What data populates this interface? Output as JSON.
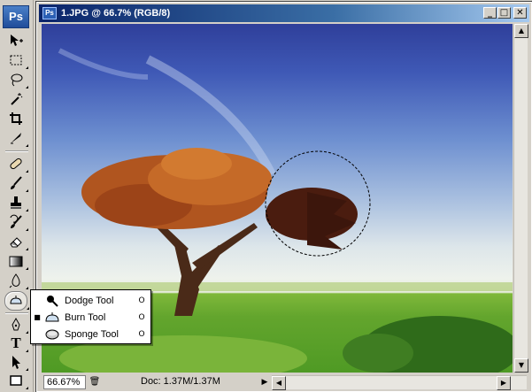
{
  "app": {
    "logo_text": "Ps"
  },
  "document": {
    "title": "1.JPG @ 66.7% (RGB/8)",
    "icon_text": "Ps",
    "buttons": {
      "minimize": "_",
      "maximize": "□",
      "close": "✕"
    }
  },
  "status": {
    "zoom": "66.67%",
    "doc_info": "Doc: 1.37M/1.37M",
    "arrow": "▶"
  },
  "scroll": {
    "up": "▲",
    "down": "▼",
    "left": "◀",
    "right": "▶"
  },
  "toolbox": {
    "tools": [
      {
        "name": "move-tool",
        "icon": "move-icon"
      },
      {
        "name": "marquee-tool",
        "icon": "rectangular-marquee-icon"
      },
      {
        "name": "lasso-tool",
        "icon": "lasso-icon"
      },
      {
        "name": "magic-wand-tool",
        "icon": "magic-wand-icon"
      },
      {
        "name": "crop-tool",
        "icon": "crop-icon"
      },
      {
        "name": "slice-tool",
        "icon": "slice-icon"
      },
      {
        "name": "healing-brush-tool",
        "icon": "bandage-icon"
      },
      {
        "name": "brush-tool",
        "icon": "brush-icon"
      },
      {
        "name": "clone-stamp-tool",
        "icon": "stamp-icon"
      },
      {
        "name": "history-brush-tool",
        "icon": "history-brush-icon"
      },
      {
        "name": "eraser-tool",
        "icon": "eraser-icon"
      },
      {
        "name": "gradient-tool",
        "icon": "gradient-icon"
      },
      {
        "name": "blur-tool",
        "icon": "blur-drop-icon"
      },
      {
        "name": "burn-tool",
        "icon": "burn-icon"
      },
      {
        "name": "pen-tool",
        "icon": "pen-icon"
      },
      {
        "name": "type-tool",
        "icon": "type-icon"
      },
      {
        "name": "path-selection-tool",
        "icon": "arrow-icon"
      },
      {
        "name": "shape-tool",
        "icon": "rectangle-shape-icon"
      }
    ],
    "type_glyph": "T"
  },
  "flyout": {
    "items": [
      {
        "label": "Dodge Tool",
        "check": "",
        "key": "O",
        "icon": "dodge-icon"
      },
      {
        "label": "Burn Tool",
        "check": "■",
        "key": "O",
        "icon": "burn-icon"
      },
      {
        "label": "Sponge Tool",
        "check": "",
        "key": "O",
        "icon": "sponge-icon"
      }
    ]
  },
  "colors": {
    "title_start": "#0a246a",
    "title_end": "#a6caf0",
    "chrome": "#d4d0c8"
  }
}
